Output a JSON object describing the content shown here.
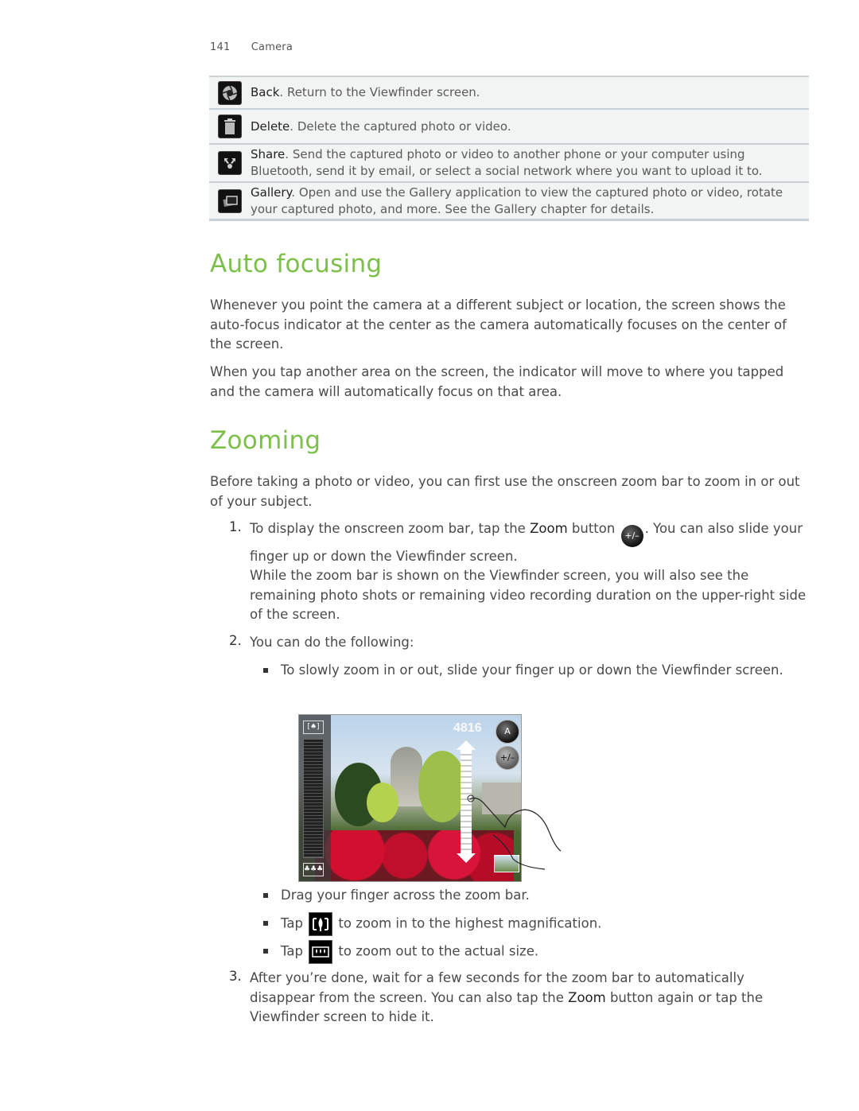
{
  "header": {
    "page_number": "141",
    "chapter": "Camera"
  },
  "icon_table": [
    {
      "icon": "camera-shutter-icon",
      "term": "Back",
      "text": ". Return to the Viewfinder screen."
    },
    {
      "icon": "trash-icon",
      "term": "Delete",
      "text": ". Delete the captured photo or video."
    },
    {
      "icon": "share-icon",
      "term": "Share",
      "text": ". Send the captured photo or video to another phone or your computer using Bluetooth, send it by email, or select a social network where you want to upload it to."
    },
    {
      "icon": "gallery-icon",
      "term": "Gallery",
      "text": ". Open and use the Gallery application to view the captured photo or video, rotate your captured photo, and more. See the Gallery chapter for details."
    }
  ],
  "auto_focusing": {
    "heading": "Auto focusing",
    "para1": "Whenever you point the camera at a different subject or location, the screen shows the auto-focus indicator at the center as the camera automatically focuses on the center of the screen.",
    "para2": "When you tap another area on the screen, the indicator will move to where you tapped and the camera will automatically focus on that area."
  },
  "zooming": {
    "heading": "Zooming",
    "intro": "Before taking a photo or video, you can first use the onscreen zoom bar to zoom in or out of your subject.",
    "step1": {
      "number": "1.",
      "pre": "To display the onscreen zoom bar, tap the ",
      "bold": "Zoom",
      "mid": " button ",
      "icon_label": "+/–",
      "post": ". You can also slide your finger up or down the Viewfinder screen.",
      "note": "While the zoom bar is shown on the Viewfinder screen, you will also see the remaining photo shots or remaining video recording duration on the upper-right side of the screen."
    },
    "step2": {
      "number": "2.",
      "text": "You can do the following:",
      "bullets": {
        "b1": "To slowly zoom in or out, slide your finger up or down the Viewfinder screen.",
        "b2": "Drag your finger across the zoom bar.",
        "b3_pre": "Tap ",
        "b3_post": " to zoom in to the highest magnification.",
        "b4_pre": "Tap ",
        "b4_post": " to zoom out to the actual size."
      }
    },
    "step3": {
      "number": "3.",
      "pre": "After you’re done, wait for a few seconds for the zoom bar to automatically disappear from the screen. You can also tap the ",
      "bold": "Zoom",
      "post": " button again or tap the Viewfinder screen to hide it."
    }
  },
  "illustration": {
    "remaining_shots": "4816",
    "flash_label": "A",
    "zoom_label": "+/–"
  }
}
